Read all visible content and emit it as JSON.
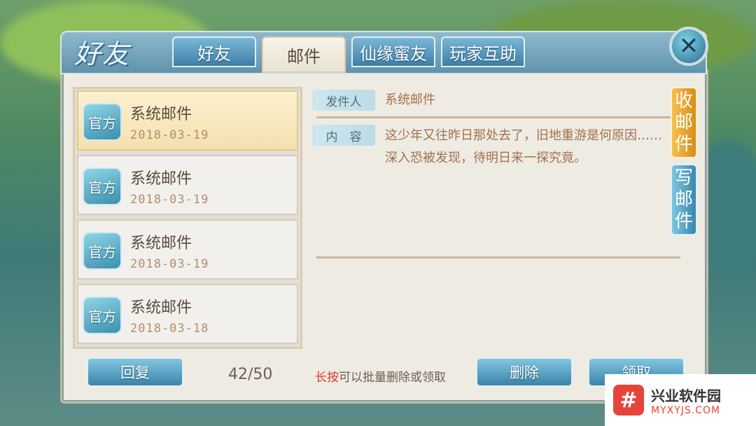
{
  "colors": {
    "accent": "#3f7fa8",
    "inbox_tab": "#d78e1c",
    "hint_red": "#e03a2a"
  },
  "window": {
    "title_logo": "好友"
  },
  "tabs": [
    {
      "label": "好友"
    },
    {
      "label": "邮件"
    },
    {
      "label": "仙缘蜜友"
    },
    {
      "label": "玩家互助"
    }
  ],
  "close_icon": "close-icon",
  "mail_list": [
    {
      "badge": "官方",
      "title": "系统邮件",
      "date": "2018-03-19"
    },
    {
      "badge": "官方",
      "title": "系统邮件",
      "date": "2018-03-19"
    },
    {
      "badge": "官方",
      "title": "系统邮件",
      "date": "2018-03-19"
    },
    {
      "badge": "官方",
      "title": "系统邮件",
      "date": "2018-03-18"
    }
  ],
  "detail": {
    "sender_label": "发件人",
    "sender_value": "系统邮件",
    "content_label": "内　容",
    "content_value": "这少年又往昨日那处去了，旧地重游是何原因……深入恐被发现，待明日来一探究竟。"
  },
  "side_tabs": {
    "inbox": "收邮件",
    "write": "写邮件"
  },
  "footer": {
    "reply_label": "回复",
    "count": "42/50",
    "hint_highlight": "长按",
    "hint_rest": "可以批量删除或领取",
    "delete_label": "删除",
    "claim_label": "领取"
  },
  "watermark": {
    "name": "兴业软件园",
    "url": "MYXYJS.COM",
    "logo_glyph": "#"
  }
}
